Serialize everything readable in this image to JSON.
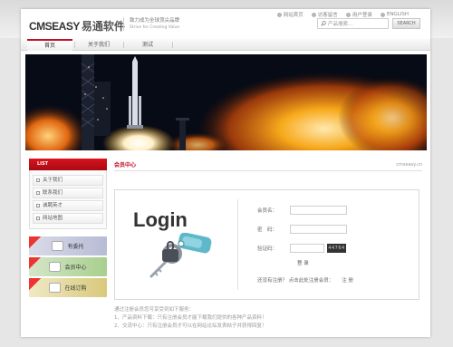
{
  "toplinks": [
    {
      "label": "网站首页",
      "icon": "home-icon"
    },
    {
      "label": "访客留言",
      "icon": "message-icon"
    },
    {
      "label": "用户登录",
      "icon": "user-icon"
    },
    {
      "label": "ENGLISH",
      "icon": "globe-icon"
    }
  ],
  "logo": {
    "en": "CMSEASY",
    "cn": "易通软件"
  },
  "slogan": {
    "line1": "致力成为全球顶尖品牌",
    "line2": "Strive for Creating Value"
  },
  "search": {
    "placeholder": "产品搜索...",
    "button": "SEARCH"
  },
  "nav": {
    "items": [
      "首页",
      "关于我们",
      "测试"
    ]
  },
  "sidebar": {
    "header": "LIST",
    "items": [
      "关于我们",
      "联系我们",
      "诚聘英才",
      "网站地图"
    ],
    "promos": [
      "有委托",
      "会员中心",
      "在线订购"
    ]
  },
  "main": {
    "title": "会员中心",
    "site": "cmseasy.cn",
    "login_word": "Login",
    "form": {
      "user_label": "会员名：",
      "pass_label": "密　码：",
      "code_label": "验证码：",
      "captcha_text": "44764",
      "submit": "登 录"
    },
    "register_prompt": "还没有注册？ 点击此处注册会员：",
    "register_link": "注 册",
    "notes": [
      "通过注册会员您可享受到如下服务：",
      "1、产品资料下载：只有注册会员才能下载我们提供的各种产品资料！",
      "2、交流中心：只有注册会员才可以在网站论坛发表帖子并获得回复！"
    ]
  },
  "colors": {
    "accent": "#c30d23",
    "banner_dark": "#0b1020",
    "flame": "#f7a91b"
  }
}
